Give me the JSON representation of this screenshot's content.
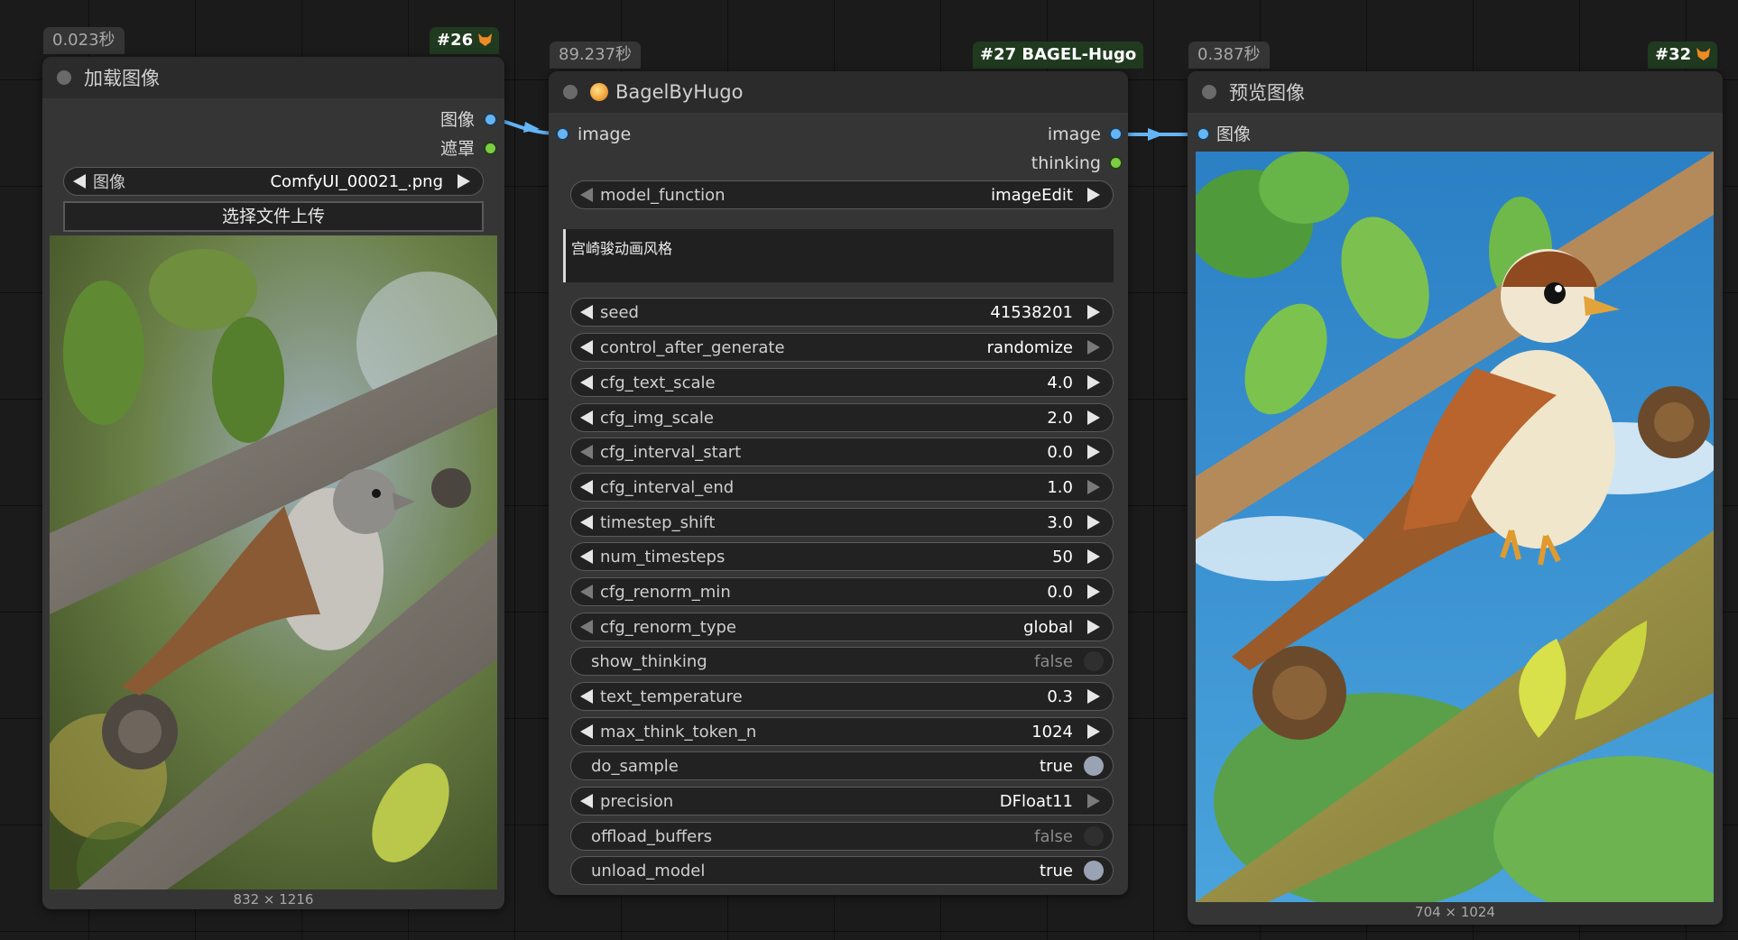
{
  "nodes": {
    "load_image": {
      "time": "0.023秒",
      "id": "#26",
      "title": "加载图像",
      "outputs": [
        "图像",
        "遮罩"
      ],
      "image_widget": {
        "label": "图像",
        "value": "ComfyUI_00021_.png"
      },
      "upload_label": "选择文件上传",
      "preview_alt": "photo-of-sparrow-on-branch",
      "dimensions": "832 × 1216"
    },
    "bagel": {
      "time": "89.237秒",
      "id": "#27 BAGEL-Hugo",
      "title": "BagelByHugo",
      "input": "image",
      "outputs": [
        "image",
        "thinking"
      ],
      "model_function": {
        "label": "model_function",
        "value": "imageEdit"
      },
      "prompt": "宫崎骏动画风格",
      "widgets": [
        {
          "label": "seed",
          "value": "41538201"
        },
        {
          "label": "control_after_generate",
          "value": "randomize"
        },
        {
          "label": "cfg_text_scale",
          "value": "4.0"
        },
        {
          "label": "cfg_img_scale",
          "value": "2.0"
        },
        {
          "label": "cfg_interval_start",
          "value": "0.0"
        },
        {
          "label": "cfg_interval_end",
          "value": "1.0"
        },
        {
          "label": "timestep_shift",
          "value": "3.0"
        },
        {
          "label": "num_timesteps",
          "value": "50"
        },
        {
          "label": "cfg_renorm_min",
          "value": "0.0"
        },
        {
          "label": "cfg_renorm_type",
          "value": "global"
        },
        {
          "label": "show_thinking",
          "value": "false"
        },
        {
          "label": "text_temperature",
          "value": "0.3"
        },
        {
          "label": "max_think_token_n",
          "value": "1024"
        },
        {
          "label": "do_sample",
          "value": "true"
        },
        {
          "label": "precision",
          "value": "DFloat11"
        },
        {
          "label": "offload_buffers",
          "value": "false"
        },
        {
          "label": "unload_model",
          "value": "true"
        }
      ]
    },
    "preview": {
      "time": "0.387秒",
      "id": "#32",
      "title": "预览图像",
      "input": "图像",
      "preview_alt": "anime-style-sparrow-illustration",
      "dimensions": "704 × 1024"
    }
  },
  "colors": {
    "canvas": "#1b1b1b",
    "node_body": "#353535",
    "node_header": "#2b2b2b",
    "image_link": "#64b5f6",
    "mask_link": "#7ccc44",
    "id_badge": "#203a20"
  }
}
